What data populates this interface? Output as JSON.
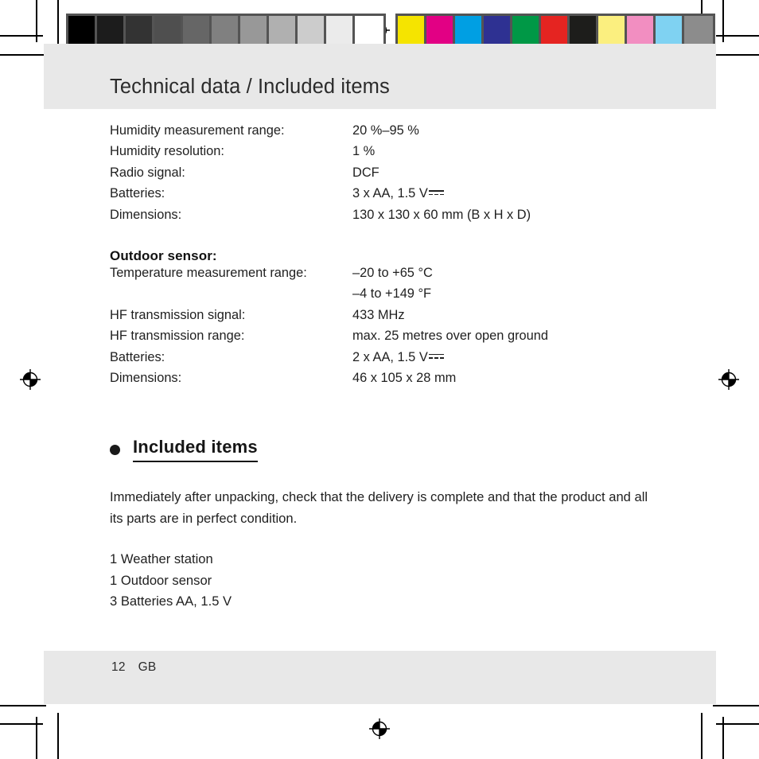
{
  "document": {
    "page_title": "Technical data / Included items",
    "footer": {
      "page_number": "12",
      "language_code": "GB"
    }
  },
  "specs_main": [
    {
      "label": "Humidity measurement range:",
      "value": "20 %–95 %"
    },
    {
      "label": "Humidity resolution:",
      "value": "1 %"
    },
    {
      "label": "Radio signal:",
      "value": "DCF"
    },
    {
      "label": "Batteries:",
      "value": "3 x AA, 1.5 V",
      "dc_symbol": true
    },
    {
      "label": "Dimensions:",
      "value": "130 x 130 x 60 mm (B x H x D)"
    }
  ],
  "outdoor_sensor": {
    "subheading": "Outdoor sensor:",
    "specs": [
      {
        "label": "Temperature measurement range:",
        "value": "–20 to +65 °C"
      },
      {
        "label": "",
        "value": "–4 to +149 °F"
      },
      {
        "label": "HF transmission signal:",
        "value": "433 MHz"
      },
      {
        "label": "HF transmission range:",
        "value": "max. 25 metres over open ground"
      },
      {
        "label": "Batteries:",
        "value": "2 x AA, 1.5 V",
        "dc_symbol": true
      },
      {
        "label": "Dimensions:",
        "value": "46 x 105 x 28 mm"
      }
    ]
  },
  "included_items": {
    "heading": "Included items",
    "paragraph": "Immediately after unpacking, check that the delivery is complete and that the product and all its parts are in perfect condition.",
    "items": [
      "1 Weather station",
      "1 Outdoor sensor",
      "3 Batteries AA, 1.5 V"
    ]
  },
  "prepress": {
    "grayscale_strip": [
      "#000000",
      "#1c1c1c",
      "#333333",
      "#4f4f4f",
      "#666666",
      "#808080",
      "#989898",
      "#b0b0b0",
      "#cccccc",
      "#ebebeb",
      "#ffffff"
    ],
    "color_strip": [
      "#f5e400",
      "#e20084",
      "#009fe3",
      "#2e3192",
      "#009846",
      "#e52421",
      "#1d1d1b",
      "#fbef7f",
      "#f28ec1",
      "#7fd2f2",
      "#8c8c8c"
    ]
  }
}
